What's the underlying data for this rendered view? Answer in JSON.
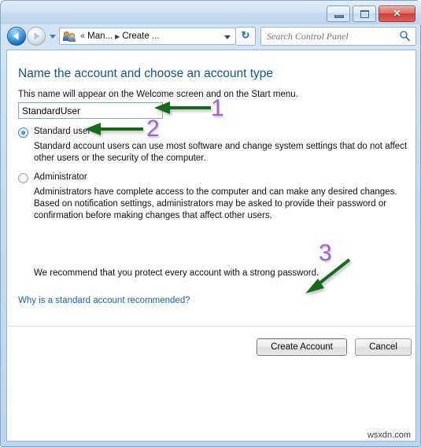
{
  "window": {
    "controls": {
      "minimize": "Minimize",
      "maximize": "Maximize",
      "close": "✕"
    }
  },
  "toolbar": {
    "back": "Back",
    "forward": "Forward",
    "recent_pages": "Recent pages",
    "breadcrumb": {
      "icon": "user-accounts-icon",
      "overflow": "«",
      "items": [
        "Man...",
        "Create ..."
      ],
      "separator": "▶"
    },
    "refresh": "↻",
    "search": {
      "placeholder": "Search Control Panel",
      "value": ""
    }
  },
  "main": {
    "title": "Name the account and choose an account type",
    "subtitle": "This name will appear on the Welcome screen and on the Start menu.",
    "name_field": {
      "value": "StandardUser",
      "placeholder": ""
    },
    "account_types": [
      {
        "id": "standard",
        "label": "Standard user",
        "selected": true,
        "description": "Standard account users can use most software and change system settings that do not affect other users or the security of the computer."
      },
      {
        "id": "administrator",
        "label": "Administrator",
        "selected": false,
        "description": "Administrators have complete access to the computer and can make any desired changes. Based on notification settings, administrators may be asked to provide their password or confirmation before making changes that affect other users."
      }
    ],
    "recommendation": "We recommend that you protect every account with a strong password.",
    "help_link": "Why is a standard account recommended?",
    "buttons": {
      "create_account": "Create Account",
      "cancel": "Cancel"
    }
  },
  "annotations": [
    {
      "number": "1",
      "target": "name-field"
    },
    {
      "number": "2",
      "target": "standard-user-radio"
    },
    {
      "number": "3",
      "target": "create-account-button"
    }
  ],
  "watermark": "wsxdn.com",
  "colors": {
    "title_blue": "#15538f",
    "link_blue": "#1364b4",
    "annotation_purple": "#9a66c7",
    "annotation_green": "#176b1d",
    "close_red": "#cf3f38"
  }
}
